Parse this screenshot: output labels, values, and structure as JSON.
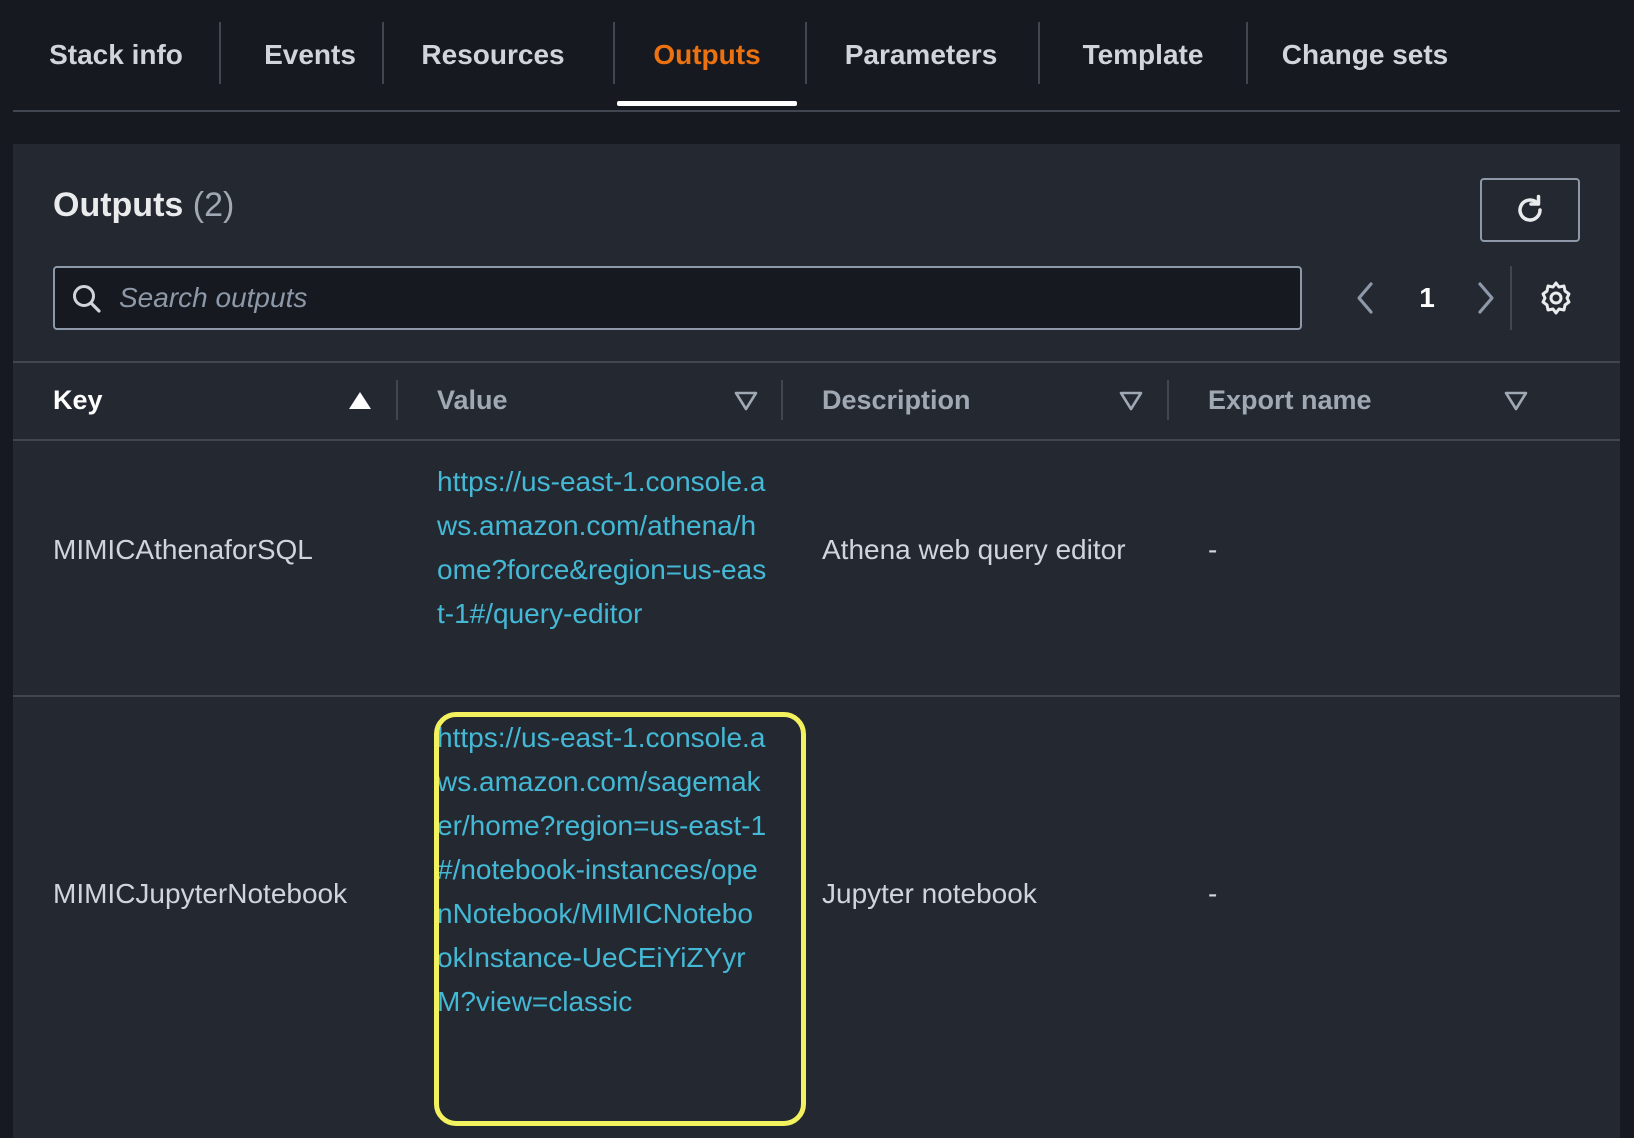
{
  "tabs": [
    {
      "label": "Stack info",
      "active": false
    },
    {
      "label": "Events",
      "active": false
    },
    {
      "label": "Resources",
      "active": false
    },
    {
      "label": "Outputs",
      "active": true
    },
    {
      "label": "Parameters",
      "active": false
    },
    {
      "label": "Template",
      "active": false
    },
    {
      "label": "Change sets",
      "active": false
    }
  ],
  "panel": {
    "title": "Outputs",
    "count": "(2)"
  },
  "search": {
    "placeholder": "Search outputs",
    "value": ""
  },
  "pagination": {
    "current_page": "1"
  },
  "table": {
    "columns": [
      {
        "label": "Key",
        "sort": "ascending"
      },
      {
        "label": "Value",
        "sort": "none"
      },
      {
        "label": "Description",
        "sort": "none"
      },
      {
        "label": "Export name",
        "sort": "none"
      }
    ],
    "rows": [
      {
        "key": "MIMICAthenaforSQL",
        "value": "https://us-east-1.console.aws.amazon.com/athena/home?force&region=us-east-1#/query-editor",
        "description": "Athena web query editor",
        "export_name": "-"
      },
      {
        "key": "MIMICJupyterNotebook",
        "value": "https://us-east-1.console.aws.amazon.com/sagemaker/home?region=us-east-1#/notebook-instances/openNotebook/MIMICNotebookInstance-UeCEiYiZYyrM?view=classic",
        "description": "Jupyter notebook",
        "export_name": "-",
        "highlighted": true
      }
    ]
  },
  "colors": {
    "background": "#16191f",
    "panel": "#232831",
    "active_tab": "#ec7211",
    "link": "#44b9d6",
    "highlight_border": "#f4f15e"
  },
  "icons": [
    "search-icon",
    "refresh-icon",
    "chevron-left-icon",
    "chevron-right-icon",
    "gear-icon",
    "sort-ascending-icon",
    "sort-descending-icon"
  ]
}
